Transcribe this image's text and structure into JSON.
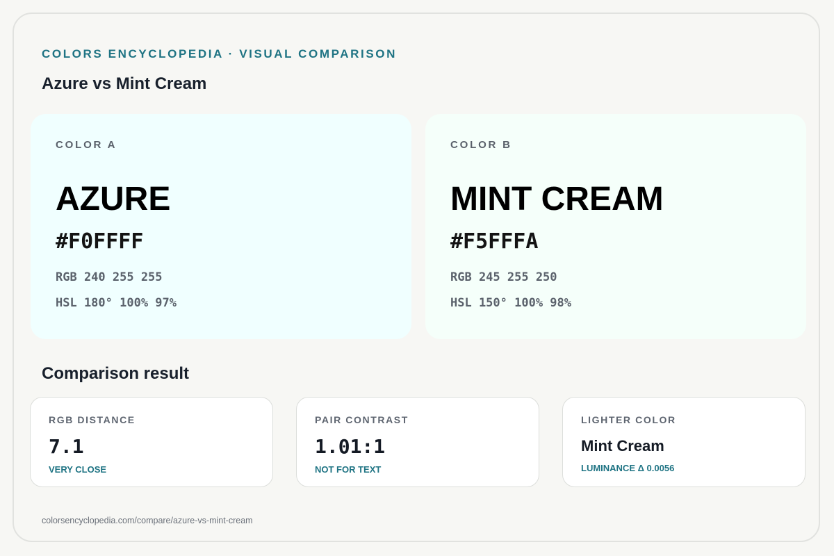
{
  "header": {
    "eyebrow": "COLORS ENCYCLOPEDIA · VISUAL COMPARISON",
    "title": "Azure vs Mint Cream"
  },
  "colors": [
    {
      "label": "COLOR A",
      "name": "AZURE",
      "hex": "#F0FFFF",
      "rgb": "RGB 240 255 255",
      "hsl": "HSL 180° 100% 97%",
      "swatch_color": "#F0FFFF"
    },
    {
      "label": "COLOR B",
      "name": "MINT CREAM",
      "hex": "#F5FFFA",
      "rgb": "RGB 245 255 250",
      "hsl": "HSL 150° 100% 98%",
      "swatch_color": "#F5FFFA"
    }
  ],
  "comparison": {
    "title": "Comparison result",
    "stats": [
      {
        "label": "RGB DISTANCE",
        "value": "7.1",
        "note": "VERY CLOSE"
      },
      {
        "label": "PAIR CONTRAST",
        "value": "1.01:1",
        "note": "NOT FOR TEXT"
      },
      {
        "label": "LIGHTER COLOR",
        "value": "Mint Cream",
        "note": "LUMINANCE Δ 0.0056"
      }
    ]
  },
  "footer": {
    "url": "colorsencyclopedia.com/compare/azure-vs-mint-cream"
  },
  "theme": {
    "accent": "#1E7383",
    "page_background": "#F7F7F4",
    "card_background": "#FFFFFF"
  }
}
